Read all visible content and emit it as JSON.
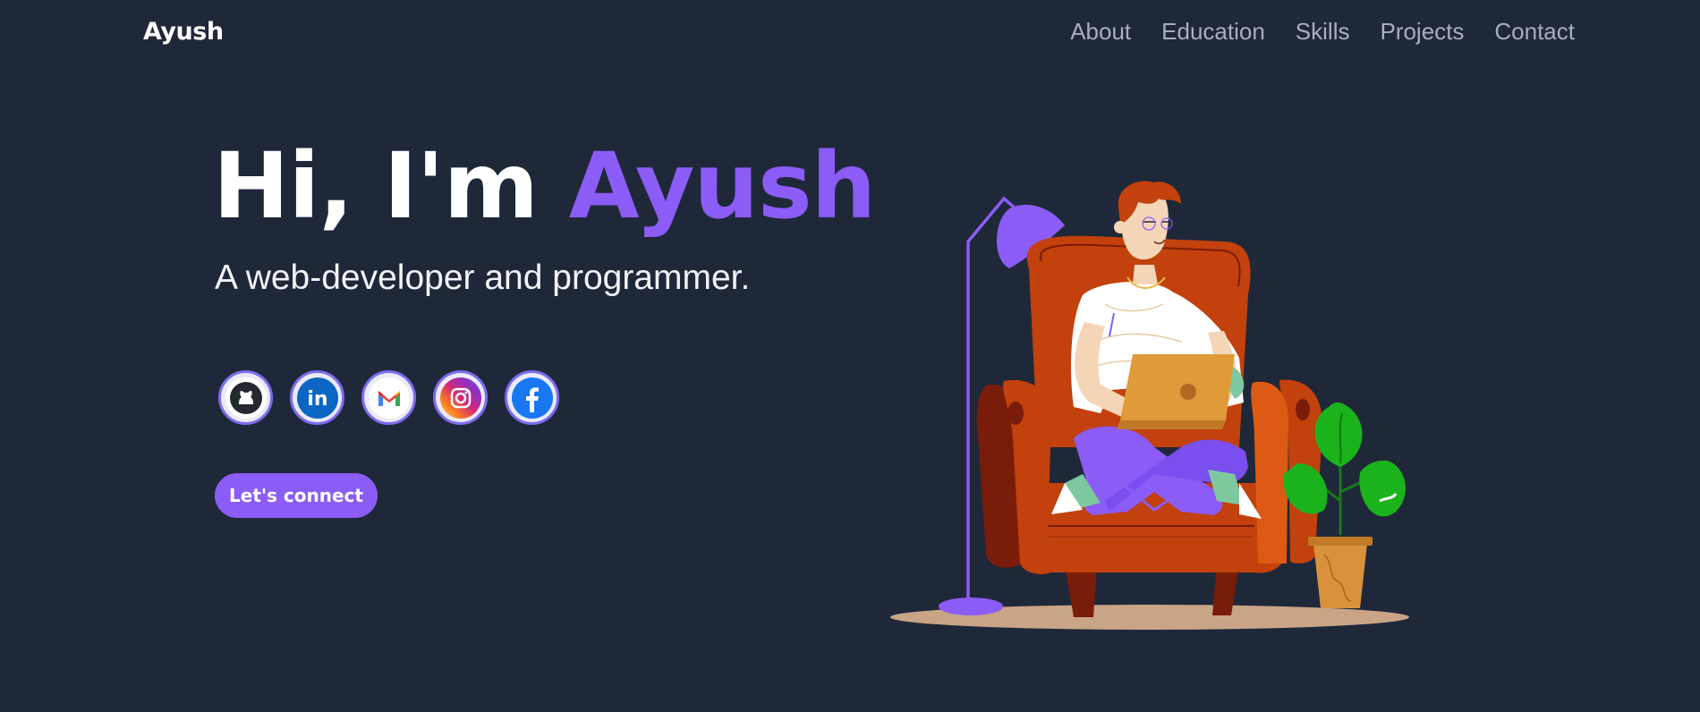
{
  "nav": {
    "brand": "Ayush",
    "links": [
      "About",
      "Education",
      "Skills",
      "Projects",
      "Contact"
    ]
  },
  "hero": {
    "greeting": "Hi, I'm ",
    "name": "Ayush",
    "subtitle": "A web-developer and programmer.",
    "cta_label": "Let's connect"
  },
  "socials": [
    {
      "name": "github",
      "icon": "github-icon"
    },
    {
      "name": "linkedin",
      "icon": "linkedin-icon"
    },
    {
      "name": "gmail",
      "icon": "gmail-icon"
    },
    {
      "name": "instagram",
      "icon": "instagram-icon"
    },
    {
      "name": "facebook",
      "icon": "facebook-icon"
    }
  ],
  "colors": {
    "background": "#1f2839",
    "accent": "#8b5cf6",
    "nav_link": "#a8aebd"
  }
}
